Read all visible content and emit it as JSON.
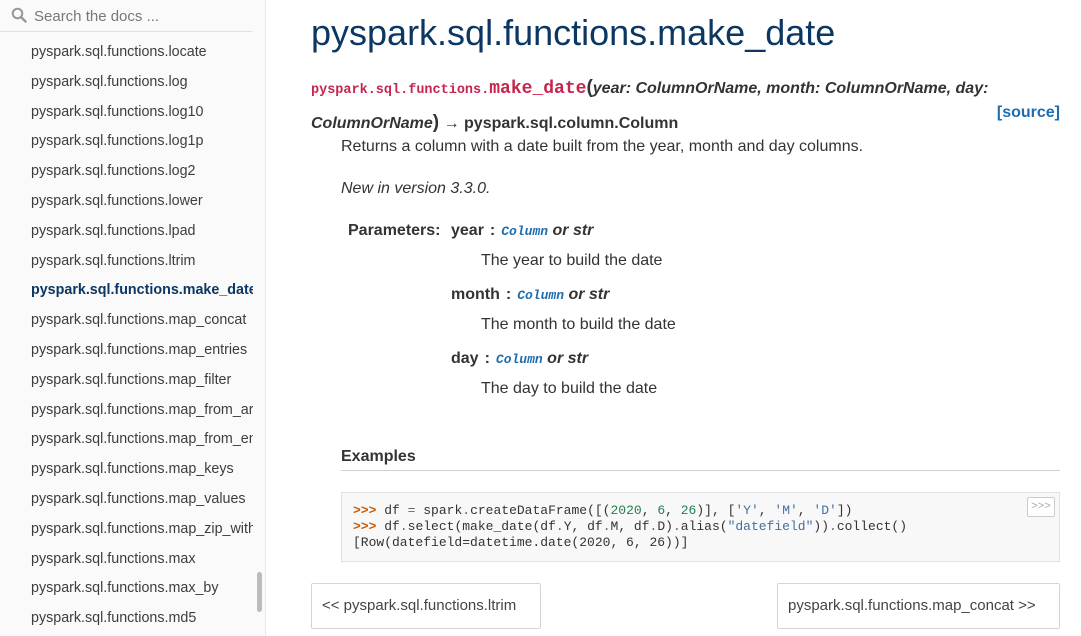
{
  "search": {
    "placeholder": "Search the docs ..."
  },
  "sidebar": {
    "items": [
      {
        "label": "pyspark.sql.functions.locate",
        "active": false
      },
      {
        "label": "pyspark.sql.functions.log",
        "active": false
      },
      {
        "label": "pyspark.sql.functions.log10",
        "active": false
      },
      {
        "label": "pyspark.sql.functions.log1p",
        "active": false
      },
      {
        "label": "pyspark.sql.functions.log2",
        "active": false
      },
      {
        "label": "pyspark.sql.functions.lower",
        "active": false
      },
      {
        "label": "pyspark.sql.functions.lpad",
        "active": false
      },
      {
        "label": "pyspark.sql.functions.ltrim",
        "active": false
      },
      {
        "label": "pyspark.sql.functions.make_date",
        "active": true
      },
      {
        "label": "pyspark.sql.functions.map_concat",
        "active": false
      },
      {
        "label": "pyspark.sql.functions.map_entries",
        "active": false
      },
      {
        "label": "pyspark.sql.functions.map_filter",
        "active": false
      },
      {
        "label": "pyspark.sql.functions.map_from_arrays",
        "active": false
      },
      {
        "label": "pyspark.sql.functions.map_from_entries",
        "active": false
      },
      {
        "label": "pyspark.sql.functions.map_keys",
        "active": false
      },
      {
        "label": "pyspark.sql.functions.map_values",
        "active": false
      },
      {
        "label": "pyspark.sql.functions.map_zip_with",
        "active": false
      },
      {
        "label": "pyspark.sql.functions.max",
        "active": false
      },
      {
        "label": "pyspark.sql.functions.max_by",
        "active": false
      },
      {
        "label": "pyspark.sql.functions.md5",
        "active": false
      }
    ]
  },
  "main": {
    "title": "pyspark.sql.functions.make_date",
    "signature": {
      "prefix": "pyspark.sql.functions.",
      "name": "make_date",
      "open": "(",
      "p1": "year: ColumnOrName",
      "sep1": ", ",
      "p2": "month: ColumnOrName",
      "sep2": ", ",
      "p3": "day: ColumnOrName",
      "close": ")",
      "arrow": " → ",
      "returns": "pyspark.sql.column.Column"
    },
    "source_label": "[source]",
    "description": "Returns a column with a date built from the year, month and day columns.",
    "version_added": "New in version 3.3.0.",
    "parameters_label": "Parameters:",
    "parameters": [
      {
        "name": "year",
        "colon": ":",
        "type_code": "Column",
        "type_rest": " or str",
        "desc": "The year to build the date"
      },
      {
        "name": "month",
        "colon": ":",
        "type_code": "Column",
        "type_rest": " or str",
        "desc": "The month to build the date"
      },
      {
        "name": "day",
        "colon": ":",
        "type_code": "Column",
        "type_rest": " or str",
        "desc": "The day to build the date"
      }
    ],
    "examples_label": "Examples",
    "code": {
      "copy_label": ">>>",
      "prompt": ">>> ",
      "l1_a": "df ",
      "l1_eq": "=",
      "l1_b": " spark",
      "l1_dot": ".",
      "l1_c": "createDataFrame([(",
      "l1_n1": "2020",
      "l1_d": ", ",
      "l1_n2": "6",
      "l1_e": ", ",
      "l1_n3": "26",
      "l1_f": ")], [",
      "l1_s1": "'Y'",
      "l1_g": ", ",
      "l1_s2": "'M'",
      "l1_h": ", ",
      "l1_s3": "'D'",
      "l1_i": "])",
      "l2_a": "df",
      "l2_dot1": ".",
      "l2_b": "select(make_date(df",
      "l2_dot2": ".",
      "l2_c": "Y, df",
      "l2_dot3": ".",
      "l2_d": "M, df",
      "l2_dot4": ".",
      "l2_e": "D)",
      "l2_dot5": ".",
      "l2_f": "alias(",
      "l2_s1": "\"datefield\"",
      "l2_g": "))",
      "l2_dot6": ".",
      "l2_h": "collect()",
      "l3": "[Row(datefield=datetime.date(2020, 6, 26))]"
    },
    "prev_label": "<< pyspark.sql.functions.ltrim",
    "next_label": "pyspark.sql.functions.map_concat >>"
  }
}
